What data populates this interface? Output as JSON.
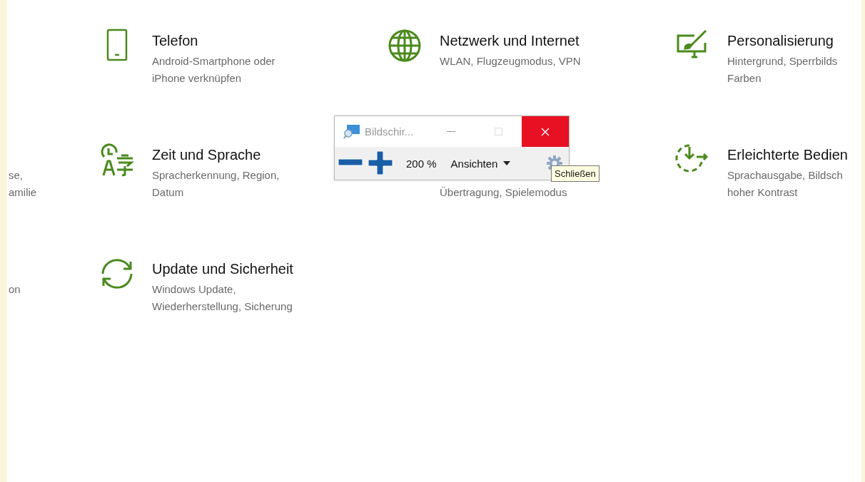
{
  "rows": [
    {
      "tiles": [
        {
          "kind": "phone",
          "title": "Telefon",
          "lines": [
            "Android-Smartphone oder",
            "iPhone verknüpfen"
          ]
        },
        {
          "kind": "globe",
          "title": "Netzwerk und Internet",
          "lines": [
            "WLAN, Flugzeugmodus, VPN"
          ]
        },
        {
          "kind": "paint",
          "title": "Personalisierung",
          "lines": [
            "Hintergrund, Sperrbilds",
            "Farben"
          ]
        }
      ]
    },
    {
      "partial_lines": [
        "se,",
        "amilie"
      ],
      "tiles": [
        {
          "kind": "time",
          "title": "Zeit und Sprache",
          "lines": [
            "Spracherkennung, Region,",
            "Datum"
          ]
        },
        {
          "kind": "none",
          "lines": [
            "Übertragung, Spielemodus"
          ]
        },
        {
          "kind": "access",
          "title": "Erleichterte Bedien",
          "lines": [
            "Sprachausgabe, Bildsch",
            "hoher Kontrast"
          ]
        }
      ]
    },
    {
      "partial_lines": [
        "on"
      ],
      "tiles": [
        {
          "kind": "sync",
          "title": "Update und Sicherheit",
          "lines": [
            "Windows Update,",
            "Wiederherstellung, Sicherung"
          ]
        }
      ]
    }
  ],
  "magnifier": {
    "title": "Bildschir...",
    "zoom": "200 %",
    "views": "Ansichten",
    "tooltip": "Schließen"
  }
}
